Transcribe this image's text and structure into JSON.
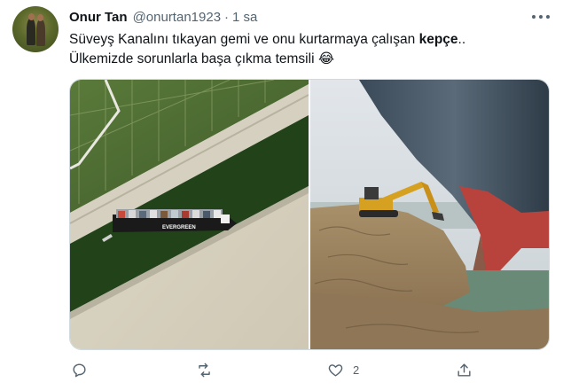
{
  "tweet": {
    "author_name": "Onur Tan",
    "handle": "@onurtan1923",
    "separator": "·",
    "time": "1 sa",
    "text_line1_before": "Süveyş Kanalını tıkayan gemi ve onu kurtarmaya çalışan ",
    "text_line1_bold": "kepçe",
    "text_line1_after": "..",
    "text_line2": "Ülkemizde sorunlarla başa çıkma temsili ",
    "emoji": "😂",
    "ship_name": "EVERGREEN",
    "icons": {
      "reply": "reply-icon",
      "retweet": "retweet-icon",
      "like": "heart-icon",
      "share": "share-icon",
      "more": "more-options-icon"
    }
  },
  "actions": {
    "reply_count": "",
    "retweet_count": "",
    "like_count": "2",
    "share_count": ""
  },
  "colors": {
    "text": "#0f1419",
    "secondary": "#536471",
    "canal_water": "#234518",
    "ship_hull": "#b8433c"
  }
}
